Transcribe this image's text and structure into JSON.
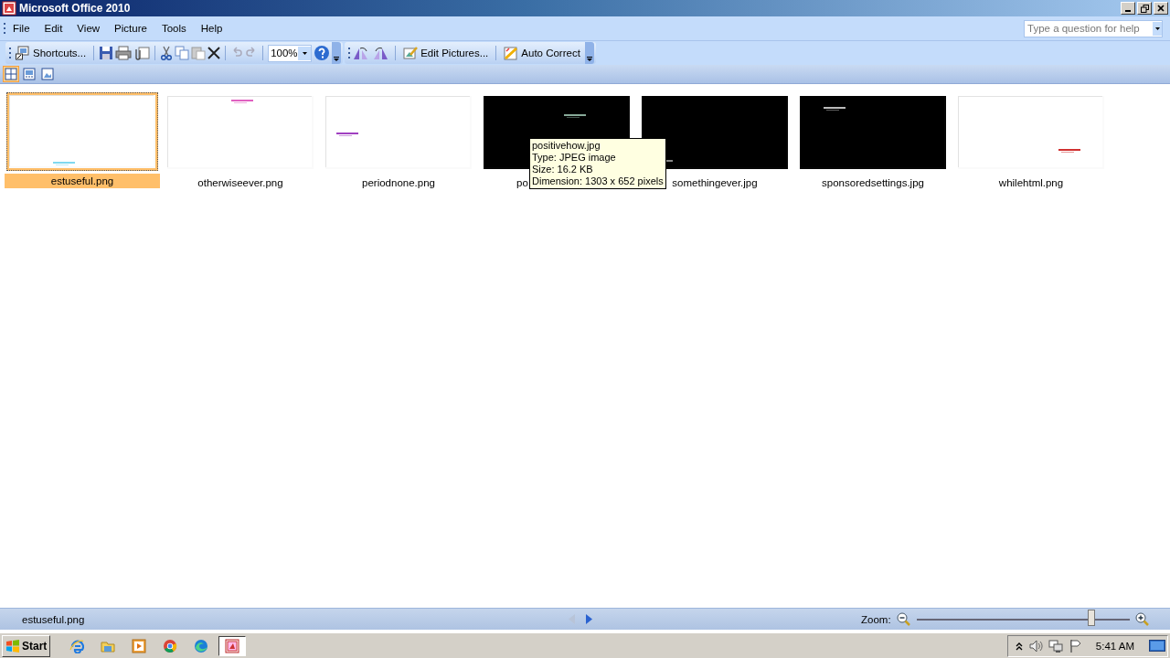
{
  "window": {
    "title": "Microsoft Office 2010"
  },
  "menu": [
    {
      "label": "File"
    },
    {
      "label": "Edit"
    },
    {
      "label": "View"
    },
    {
      "label": "Picture"
    },
    {
      "label": "Tools"
    },
    {
      "label": "Help"
    }
  ],
  "help_search": {
    "placeholder": "Type a question for help"
  },
  "toolbar": {
    "shortcuts": "Shortcuts...",
    "zoom_value": "100%",
    "edit_pictures": "Edit Pictures...",
    "auto_correct": "Auto Correct",
    "undo_disabled": true,
    "redo_disabled": true,
    "paste_disabled": true
  },
  "view_modes": [
    {
      "selected": true
    },
    {
      "selected": false
    },
    {
      "selected": false
    }
  ],
  "thumbnails": [
    {
      "name": "estuseful.png",
      "selected": true,
      "kind": "picture"
    },
    {
      "name": "otherwiseever.png",
      "selected": false,
      "kind": "picture"
    },
    {
      "name": "periodnone.png",
      "selected": false,
      "kind": "picture"
    },
    {
      "name": "po",
      "selected": false,
      "kind": "picture",
      "tooltip": [
        "positivehow.jpg",
        "Type: JPEG image",
        "Size: 16.2 KB",
        "Dimension: 1303 x 652 pixels"
      ]
    },
    {
      "name": "somethingever.jpg",
      "selected": false,
      "kind": "picture"
    },
    {
      "name": "sponsoredsettings.jpg",
      "selected": false,
      "kind": "picture"
    },
    {
      "name": "whilehtml.png",
      "selected": false,
      "kind": "picture"
    }
  ],
  "status_bar": {
    "filename": "estuseful.png",
    "prev_disabled": true,
    "next_disabled": false,
    "zoom_label": "Zoom:",
    "level": 0.82
  },
  "taskbar": {
    "start": "Start",
    "apps": [
      {
        "selected": false
      },
      {
        "selected": false
      },
      {
        "selected": false
      },
      {
        "selected": false
      },
      {
        "selected": false
      },
      {
        "selected": true
      }
    ],
    "clock": "5:41 AM"
  }
}
